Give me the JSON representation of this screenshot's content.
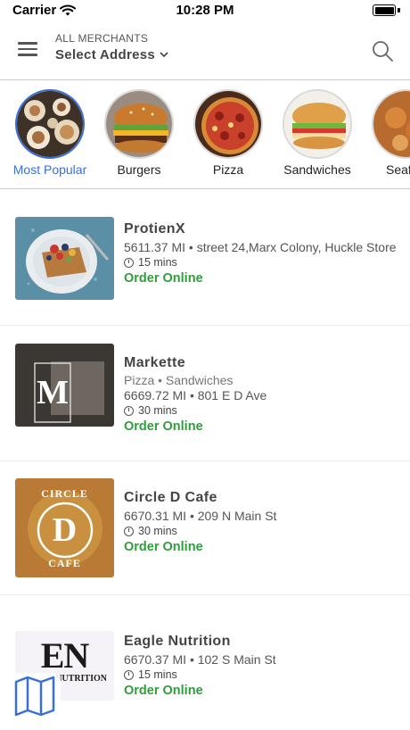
{
  "status_bar": {
    "carrier": "Carrier",
    "time": "10:28 PM",
    "battery_level": 1.0
  },
  "header": {
    "subtitle": "ALL MERCHANTS",
    "address_label": "Select Address",
    "menu_icon": "hamburger-icon",
    "search_icon": "search-icon"
  },
  "categories": [
    {
      "label": "Most Popular",
      "active": true
    },
    {
      "label": "Burgers",
      "active": false
    },
    {
      "label": "Pizza",
      "active": false
    },
    {
      "label": "Sandwiches",
      "active": false
    },
    {
      "label": "Seaf",
      "active": false
    }
  ],
  "merchants": [
    {
      "name": "ProtienX",
      "tags": "",
      "address": "5611.37 MI • street 24,Marx Colony, Huckle Store",
      "time": "15 mins",
      "order": "Order Online"
    },
    {
      "name": "Markette",
      "tags": "Pizza • Sandwiches",
      "address": "6669.72 MI • 801 E D Ave",
      "time": "30 mins",
      "order": "Order Online",
      "logo_text": "M"
    },
    {
      "name": "Circle D Cafe",
      "tags": "",
      "address": "6670.31 MI • 209 N Main St",
      "time": "30 mins",
      "order": "Order Online",
      "logo_text": "D",
      "logo_top": "CIRCLE",
      "logo_bottom": "CAFE"
    },
    {
      "name": "Eagle Nutrition",
      "tags": "",
      "address": "6670.37 MI • 102 S Main St",
      "time": "15 mins",
      "order": "Order Online",
      "logo_text": "EN",
      "logo_sub": "NUTRITION"
    }
  ],
  "colors": {
    "accent": "#3a6fd8",
    "order_green": "#2f9e3a"
  },
  "map_button": {
    "icon": "map-icon"
  }
}
